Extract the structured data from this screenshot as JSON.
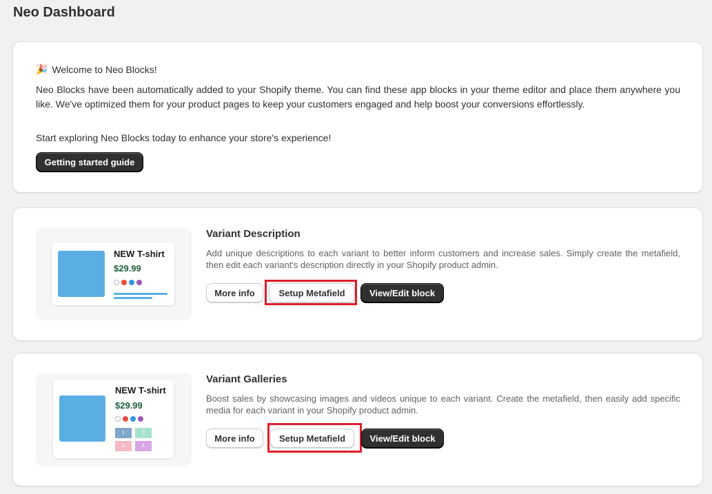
{
  "page": {
    "title": "Neo Dashboard"
  },
  "welcome": {
    "icon": "party-popper-icon",
    "title": "Welcome to Neo Blocks!",
    "body": "Neo Blocks have been automatically added to your Shopify theme. You can find these app blocks in your theme editor and place them anywhere you like. We've optimized them for your product pages to keep your customers engaged and help boost your conversions effortlessly.",
    "cta_text": "Start exploring Neo Blocks today to enhance your store's experience!",
    "guide_button": "Getting started guide"
  },
  "variant_description": {
    "title": "Variant Description",
    "description": "Add unique descriptions to each variant to better inform customers and increase sales. Simply create the metafield, then edit each variant's description directly in your Shopify product admin.",
    "more_info": "More info",
    "setup_metafield": "Setup Metafield",
    "view_edit": "View/Edit block",
    "preview": {
      "name": "NEW T-shirt",
      "price": "$29.99"
    }
  },
  "variant_galleries": {
    "title": "Variant Galleries",
    "description": "Boost sales by showcasing images and videos unique to each variant. Create the metafield, then easily add specific media for each variant in your Shopify product admin.",
    "more_info": "More info",
    "setup_metafield": "Setup Metafield",
    "view_edit": "View/Edit block",
    "preview": {
      "name": "NEW T-shirt",
      "price": "$29.99",
      "thumbs": [
        "1",
        "2",
        "3",
        "4"
      ]
    }
  },
  "colors": {
    "accent_dark": "#303030",
    "highlight_red": "#e21b2b",
    "price_green": "#1b5e3a",
    "image_blue": "#5aaee3",
    "swatch_colors": [
      "#ffffff",
      "#e74c3c",
      "#3498db",
      "#9b59b6"
    ]
  }
}
